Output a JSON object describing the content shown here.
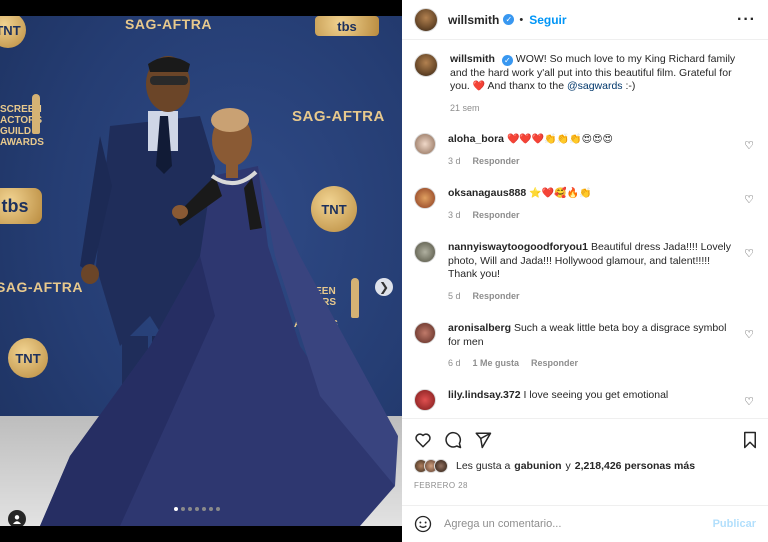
{
  "media": {
    "logos": {
      "sag_aftra": "SAG-AFTRA",
      "tbs": "tbs",
      "tnt": "TNT",
      "screen_actors_guild": "SCREEN ACTORS GUILD AWARDS"
    },
    "carousel": {
      "total": 7,
      "active_index": 0
    }
  },
  "header": {
    "username": "willsmith",
    "follow_label": "Seguir",
    "more_icon": "more-options-icon"
  },
  "caption": {
    "username": "willsmith",
    "text_1": "WOW! So much love to my King Richard family and the hard work y'all put into this beautiful film. Grateful for you. ",
    "heart": "❤️",
    "text_2": " And thanx to the ",
    "mention": "@sagwards",
    "text_3": " :-)",
    "time": "21 sem"
  },
  "comments": [
    {
      "username": "aloha_bora",
      "text": "❤️❤️❤️👏👏👏😍😍😍",
      "time": "3 d",
      "likes": "",
      "reply": "Responder"
    },
    {
      "username": "oksanagaus888",
      "text": "⭐❤️🥰🔥👏",
      "time": "3 d",
      "likes": "",
      "reply": "Responder"
    },
    {
      "username": "nannyiswaytoogoodforyou1",
      "text": "Beautiful dress Jada!!!! Lovely photo, Will and Jada!!! Hollywood glamour, and talent!!!!! Thank you!",
      "time": "5 d",
      "likes": "",
      "reply": "Responder"
    },
    {
      "username": "aronisalberg",
      "text": "Such a weak little beta boy a disgrace symbol for men",
      "time": "6 d",
      "likes": "1 Me gusta",
      "reply": "Responder"
    },
    {
      "username": "lily.lindsay.372",
      "text": "I love seeing you get emotional",
      "time": "",
      "likes": "",
      "reply": ""
    }
  ],
  "likes": {
    "prefix": "Les gusta a",
    "user": "gabunion",
    "middle": "y",
    "count": "2,218,426 personas más"
  },
  "date": "FEBRERO 28",
  "composer": {
    "placeholder": "Agrega un comentario...",
    "post_label": "Publicar"
  },
  "colors": {
    "accent": "#0095f6",
    "verified": "#3897f0",
    "heart": "#ed4956",
    "muted": "#8e8e8e"
  }
}
